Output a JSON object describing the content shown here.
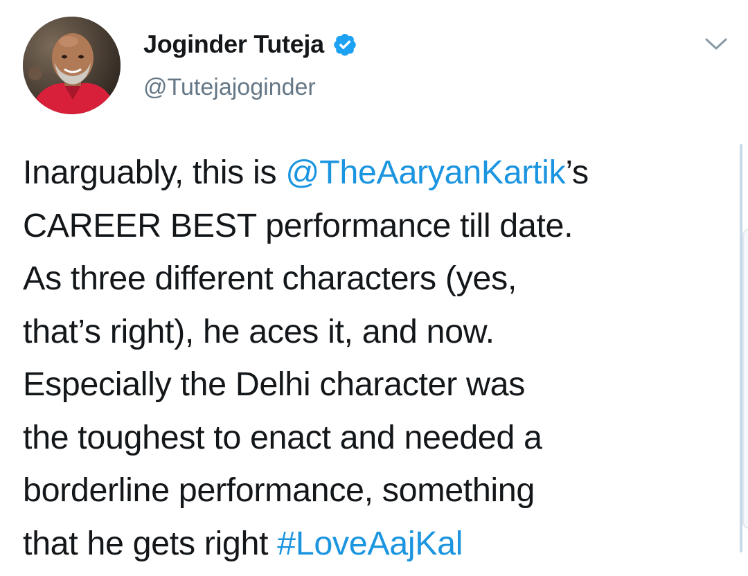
{
  "user": {
    "display_name": "Joginder Tuteja",
    "handle": "@Tutejajoginder",
    "verified": true,
    "avatar_icon": "profile-photo"
  },
  "menu": {
    "icon": "chevron-down-icon"
  },
  "tweet": {
    "lines": [
      [
        {
          "text": "Inarguably, this is ",
          "link": false
        },
        {
          "text": "@TheAaryanKartik",
          "link": true
        },
        {
          "text": "’s",
          "link": false
        }
      ],
      [
        {
          "text": "CAREER BEST performance till date.",
          "link": false
        }
      ],
      [
        {
          "text": "As three different characters (yes,",
          "link": false
        }
      ],
      [
        {
          "text": "that’s right), he aces it, and now.",
          "link": false
        }
      ],
      [
        {
          "text": "Especially the Delhi character was",
          "link": false
        }
      ],
      [
        {
          "text": "the toughest to enact and needed a",
          "link": false
        }
      ],
      [
        {
          "text": "borderline performance, something",
          "link": false
        }
      ],
      [
        {
          "text": "that he gets right ",
          "link": false
        },
        {
          "text": "#LoveAajKal",
          "link": true
        }
      ]
    ]
  },
  "colors": {
    "link": "#1b95e0",
    "text": "#14171a",
    "secondary": "#657786",
    "verified_badge": "#1da1f2"
  }
}
